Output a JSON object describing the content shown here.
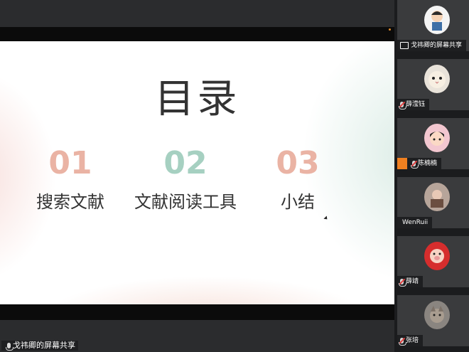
{
  "slide": {
    "title": "目录",
    "sections": [
      {
        "number": "01",
        "label": "搜索文献",
        "color": "#eab3a4"
      },
      {
        "number": "02",
        "label": "文献阅读工具",
        "color": "#a6d0c1"
      },
      {
        "number": "03",
        "label": "小结",
        "color": "#eab3a4"
      }
    ]
  },
  "share_caption": "戈祎卿的屏幕共享",
  "participants": [
    {
      "name": "戈祎卿的屏幕共享",
      "avatar_icon": "cartoon-person-avatar",
      "mic": "share"
    },
    {
      "name": "薛滢钰",
      "avatar_icon": "cat-avatar",
      "mic": "off"
    },
    {
      "name": "陈楠楠",
      "avatar_icon": "cartoon-girl-avatar",
      "mic": "off"
    },
    {
      "name": "WenRuii",
      "avatar_icon": "photo-avatar",
      "mic": "none"
    },
    {
      "name": "薛靖",
      "avatar_icon": "festive-pig-avatar",
      "mic": "off"
    },
    {
      "name": "张培",
      "avatar_icon": "cat-photo-avatar",
      "mic": "off"
    }
  ]
}
